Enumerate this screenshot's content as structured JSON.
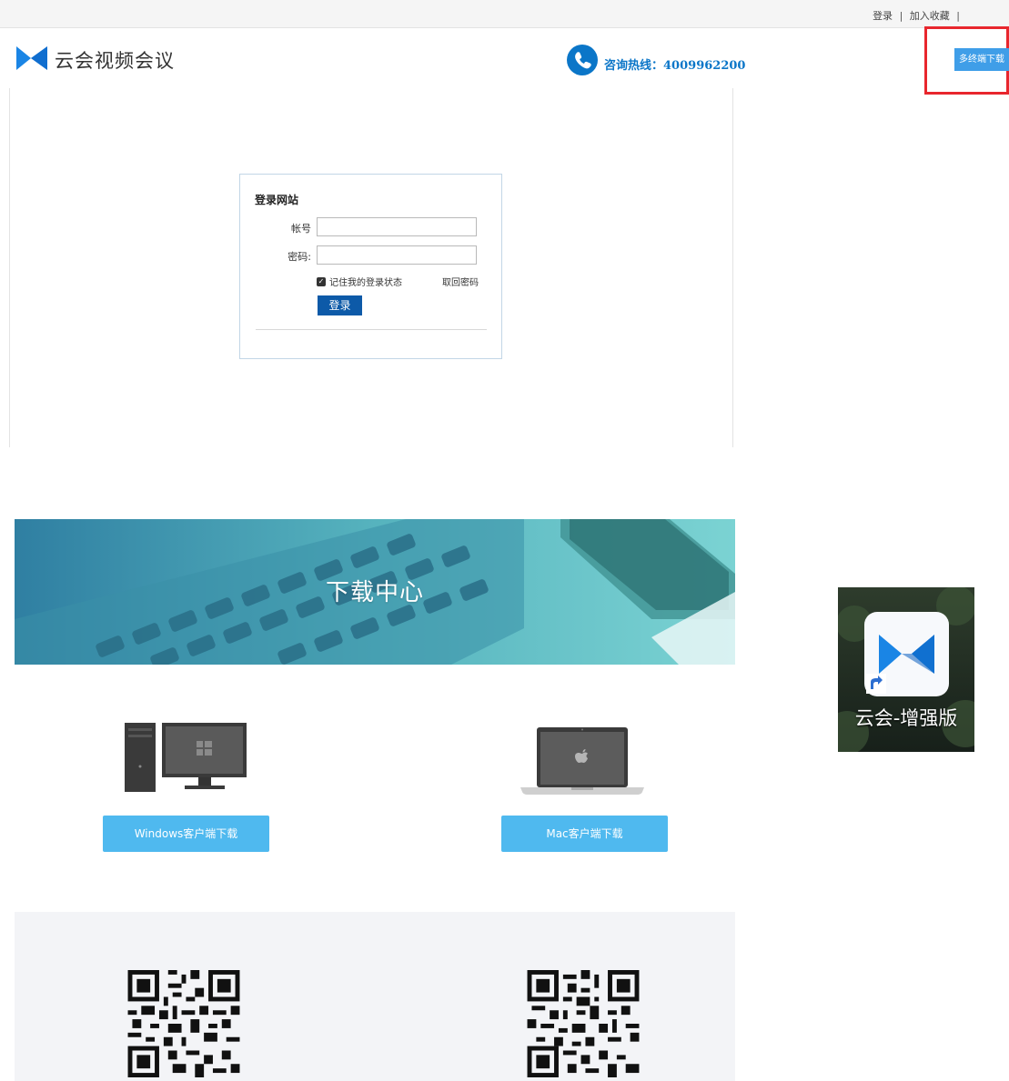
{
  "topbar": {
    "login_link": "登录",
    "separator": "|",
    "favorite_link": "加入收藏"
  },
  "header": {
    "logo_text": "云会视频会议",
    "hotline_label": "咨询热线：",
    "hotline_number": "4009962200",
    "multi_download_button": "多终端下载",
    "highlight_color": "#e8262d",
    "brand_color": "#0b76c8"
  },
  "login": {
    "title": "登录网站",
    "account_label": "帐号",
    "password_label": "密码:",
    "account_value": "",
    "password_value": "",
    "remember_checked": true,
    "remember_label": "记住我的登录状态",
    "retrieve_link": "取回密码",
    "submit_label": "登录"
  },
  "download_center": {
    "banner_title": "下载中心",
    "windows_button": "Windows客户端下载",
    "mac_button": "Mac客户端下载",
    "button_color": "#4fb9ef"
  },
  "qr_section": {
    "icons": [
      "qr-code",
      "qr-code"
    ]
  },
  "desktop_shortcut": {
    "label": "云会-增强版",
    "icon": "yunhui-app-icon"
  }
}
